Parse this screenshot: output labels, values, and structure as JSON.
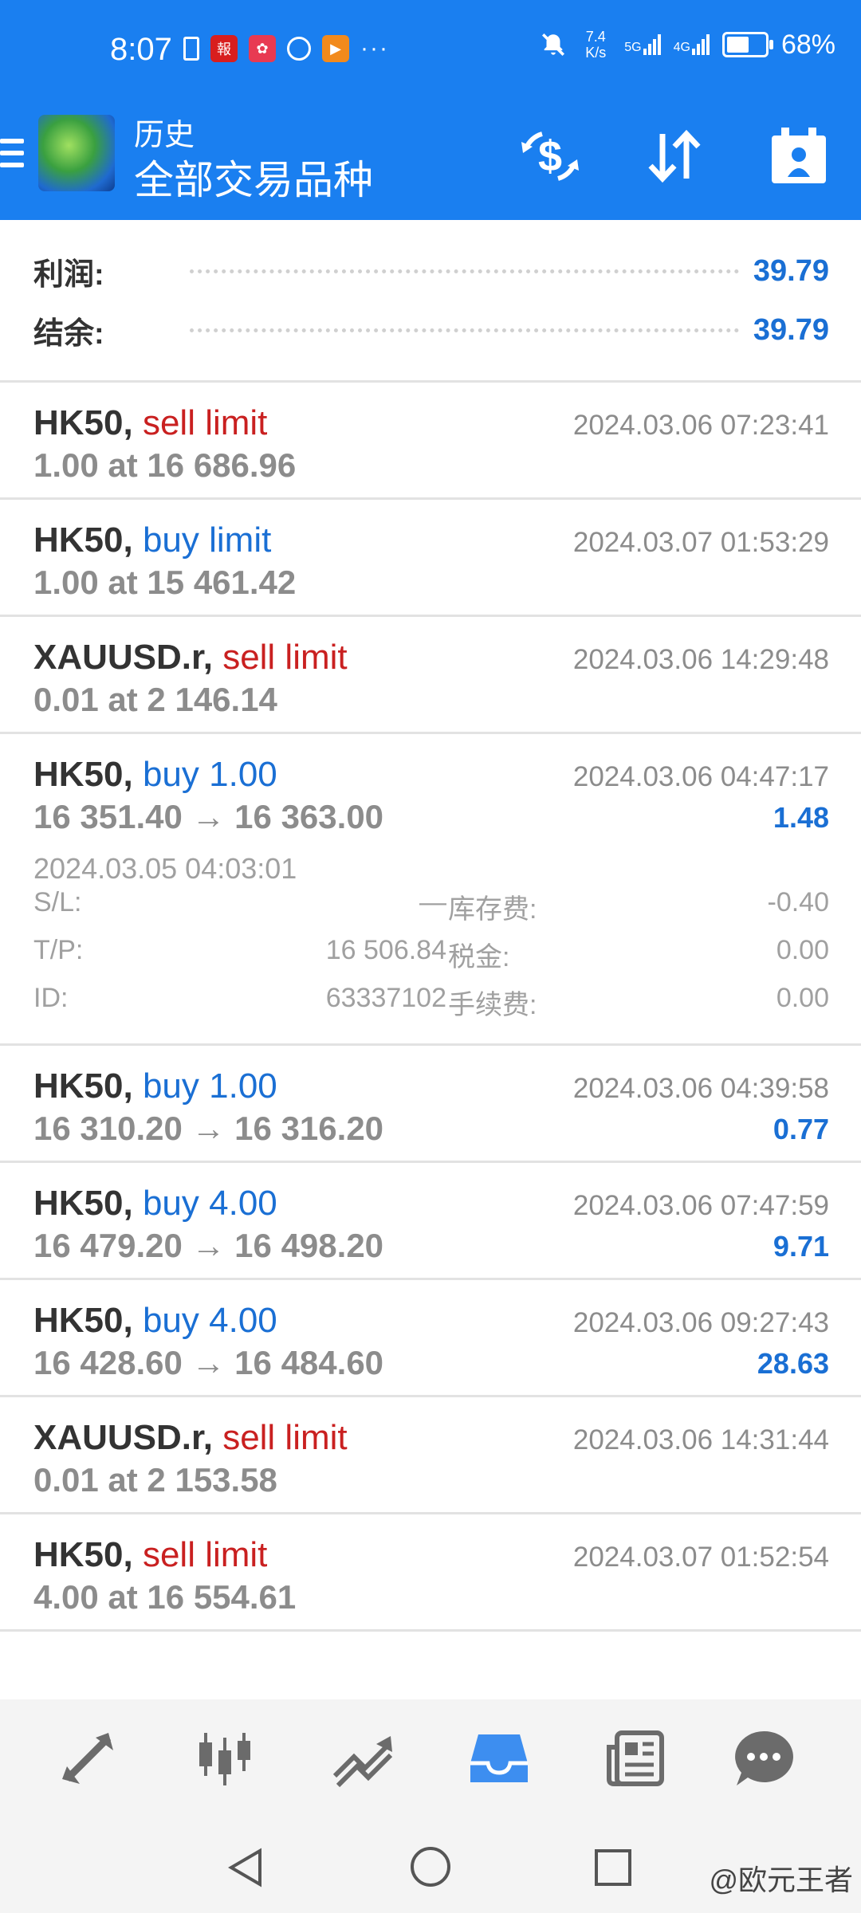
{
  "status_bar": {
    "time": "8:07",
    "network_speed": "7.4 K/s",
    "signal_1": "5G",
    "signal_2": "4G",
    "battery_percent": "68%",
    "battery_level": 0.68,
    "overflow": "···"
  },
  "app_bar": {
    "title_small": "历史",
    "title_big": "全部交易品种"
  },
  "summary": {
    "profit_label": "利润:",
    "profit_value": "39.79",
    "balance_label": "结余:",
    "balance_value": "39.79"
  },
  "records": [
    {
      "symbol": "HK50,",
      "type": "sell limit",
      "side": "sell",
      "detail": "1.00 at 16 686.96",
      "time": "2024.03.06 07:23:41",
      "profit": ""
    },
    {
      "symbol": "HK50,",
      "type": "buy limit",
      "side": "buy",
      "detail": "1.00 at 15 461.42",
      "time": "2024.03.07 01:53:29",
      "profit": ""
    },
    {
      "symbol": "XAUUSD.r,",
      "type": "sell limit",
      "side": "sell",
      "detail": "0.01 at 2 146.14",
      "time": "2024.03.06 14:29:48",
      "profit": ""
    },
    {
      "symbol": "HK50,",
      "type": "buy 1.00",
      "side": "buy",
      "detail": "16 351.40 → 16 363.00",
      "time": "2024.03.06 04:47:17",
      "profit": "1.48"
    },
    {
      "symbol": "HK50,",
      "type": "buy 1.00",
      "side": "buy",
      "detail": "16 310.20 → 16 316.20",
      "time": "2024.03.06 04:39:58",
      "profit": "0.77"
    },
    {
      "symbol": "HK50,",
      "type": "buy 4.00",
      "side": "buy",
      "detail": "16 479.20 → 16 498.20",
      "time": "2024.03.06 07:47:59",
      "profit": "9.71"
    },
    {
      "symbol": "HK50,",
      "type": "buy 4.00",
      "side": "buy",
      "detail": "16 428.60 → 16 484.60",
      "time": "2024.03.06 09:27:43",
      "profit": "28.63"
    },
    {
      "symbol": "XAUUSD.r,",
      "type": "sell limit",
      "side": "sell",
      "detail": "0.01 at 2 153.58",
      "time": "2024.03.06 14:31:44",
      "profit": ""
    },
    {
      "symbol": "HK50,",
      "type": "sell limit",
      "side": "sell",
      "detail": "4.00 at 16 554.61",
      "time": "2024.03.07 01:52:54",
      "profit": ""
    }
  ],
  "expanded_details": {
    "open_time": "2024.03.05 04:03:01",
    "sl_label": "S/L:",
    "sl_value": "—",
    "tp_label": "T/P:",
    "tp_value": "16 506.84",
    "id_label": "ID:",
    "id_value": "63337102",
    "swap_label": "库存费:",
    "swap_value": "-0.40",
    "tax_label": "税金:",
    "tax_value": "0.00",
    "commission_label": "手续费:",
    "commission_value": "0.00"
  },
  "bottom_nav": {
    "items": [
      "quotes-icon",
      "chart-icon",
      "trade-icon",
      "history-icon",
      "news-icon",
      "chat-icon"
    ],
    "active": "history-icon"
  },
  "watermark": "@欧元王者",
  "colors": {
    "accent": "#1a7ff0",
    "sell": "#c92020",
    "buy": "#1a6fd4",
    "profit": "#1a6fd4"
  }
}
